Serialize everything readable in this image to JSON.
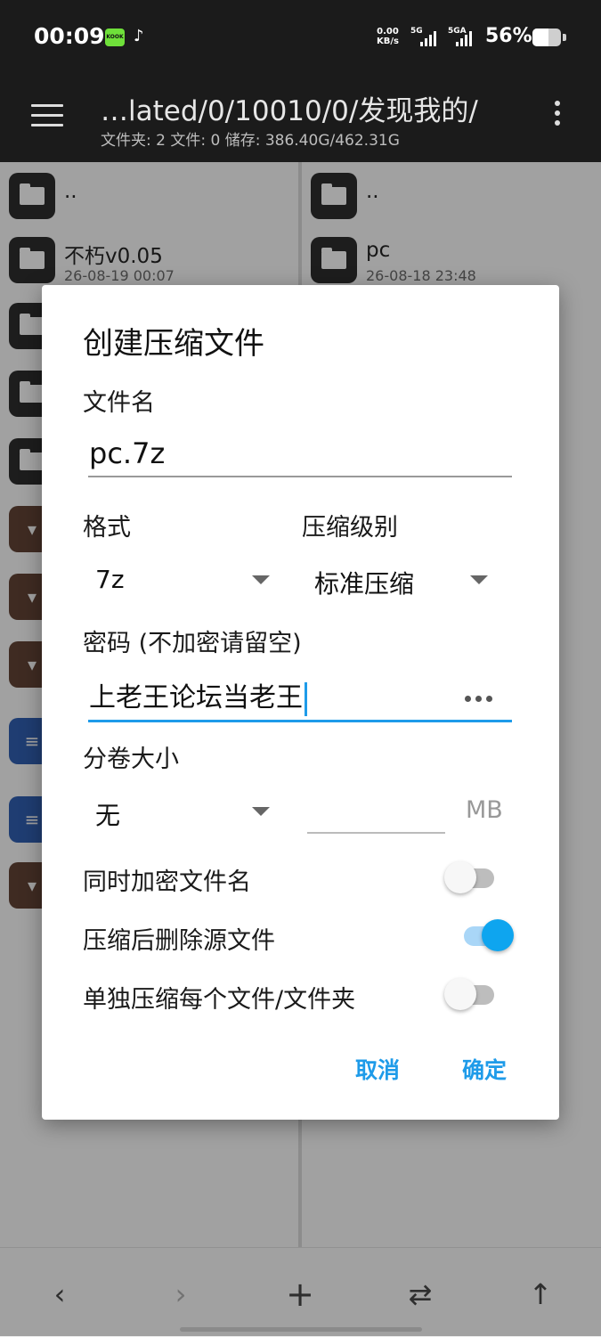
{
  "status_bar": {
    "time": "00:09",
    "app1_label": "KOOK",
    "app2_glyph": "♪",
    "net_speed_value": "0.00",
    "net_speed_unit": "KB/s",
    "sim1_label": "5G",
    "sim2_label": "5GA",
    "battery_percent": "56%",
    "battery_level": 0.56
  },
  "toolbar": {
    "path": "…lated/0/10010/0/发现我的/",
    "summary": "文件夹: 2  文件: 0  储存: 386.40G/462.31G"
  },
  "left_pane": {
    "items": [
      {
        "name": "..",
        "date": ""
      },
      {
        "name": "不朽v0.05",
        "date": "26-08-19 00:07"
      }
    ]
  },
  "right_pane": {
    "items": [
      {
        "name": "..",
        "date": ""
      },
      {
        "name": "pc",
        "date": "26-08-18 23:48"
      }
    ]
  },
  "dialog": {
    "title": "创建压缩文件",
    "filename_label": "文件名",
    "filename_value": "pc.7z",
    "format_label": "格式",
    "format_value": "7z",
    "level_label": "压缩级别",
    "level_value": "标准压缩",
    "password_label": "密码 (不加密请留空)",
    "password_value": "上老王论坛当老王",
    "split_label": "分卷大小",
    "split_value": "无",
    "split_size_value": "",
    "split_unit": "MB",
    "switches": [
      {
        "label": "同时加密文件名",
        "on": false
      },
      {
        "label": "压缩后删除源文件",
        "on": true
      },
      {
        "label": "单独压缩每个文件/文件夹",
        "on": false
      }
    ],
    "cancel_label": "取消",
    "ok_label": "确定"
  },
  "bottom_bar": {
    "back_glyph": "‹",
    "forward_glyph": "›",
    "add_glyph": "+",
    "swap_glyph": "⇄",
    "up_glyph": "↑"
  },
  "colors": {
    "accent": "#1e9be9",
    "switch_on": "#0ea5ef",
    "header_bg": "#1b1b1b"
  }
}
